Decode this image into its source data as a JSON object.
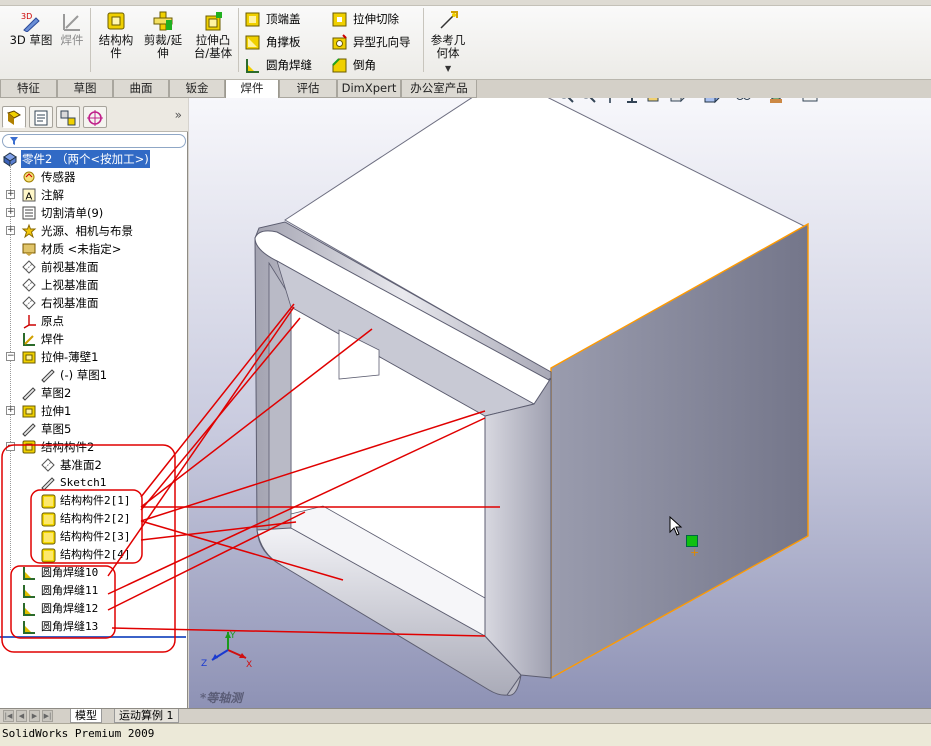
{
  "ribbon": {
    "sketch3d": "3D 草图",
    "weldment": "焊件",
    "structural_member": [
      "结构构",
      "件"
    ],
    "trim_extend": [
      "剪裁/延",
      "伸"
    ],
    "extruded_boss": [
      "拉伸凸",
      "台/基体"
    ],
    "end_cap": "顶端盖",
    "gusset": "角撑板",
    "fillet_bead": "圆角焊缝",
    "extruded_cut": "拉伸切除",
    "hole_wizard": "异型孔向导",
    "chamfer": "倒角",
    "ref_geometry": [
      "参考几",
      "何体"
    ]
  },
  "cmd_tabs": [
    "特征",
    "草图",
    "曲面",
    "钣金",
    "焊件",
    "评估",
    "DimXpert",
    "办公室产品"
  ],
  "active_cmd_tab": "焊件",
  "feature_tree": {
    "part": "零件2 （两个<按加工>)",
    "items": [
      "传感器",
      "注解",
      "切割清单(9)",
      "光源、相机与布景",
      "材质 <未指定>",
      "前视基准面",
      "上视基准面",
      "右视基准面",
      "原点",
      "焊件",
      "拉伸-薄壁1",
      "(-) 草图1",
      "草图2",
      "拉伸1",
      "草图5",
      "结构构件2",
      "基准面2",
      "Sketch1",
      "结构构件2[1]",
      "结构构件2[2]",
      "结构构件2[3]",
      "结构构件2[4]",
      "圆角焊缝10",
      "圆角焊缝11",
      "圆角焊缝12",
      "圆角焊缝13"
    ]
  },
  "bottom_tabs": [
    "模型",
    "运动算例 1"
  ],
  "active_bottom_tab": "模型",
  "status": "SolidWorks Premium 2009",
  "view_label": "*等轴测",
  "triad": {
    "x": "X",
    "y": "Y",
    "z": "Z"
  },
  "icons": {
    "sketch3d": "3d-sketch-icon",
    "weldment": "weldment-icon",
    "structural": "structural-member-icon",
    "trim": "trim-extend-icon",
    "extrude": "extruded-boss-icon",
    "endcap": "end-cap-icon",
    "gusset": "gusset-icon",
    "fillet": "fillet-bead-icon",
    "cut": "extruded-cut-icon",
    "hole": "hole-wizard-icon",
    "chamfer": "chamfer-icon",
    "refgeom": "reference-geometry-icon"
  },
  "colors": {
    "selection": "#316ac5",
    "annotation": "#e00000",
    "highlight_edge": "#ff9a00",
    "viewport_top": "#f7f7fb",
    "viewport_bottom": "#8e92b5"
  }
}
